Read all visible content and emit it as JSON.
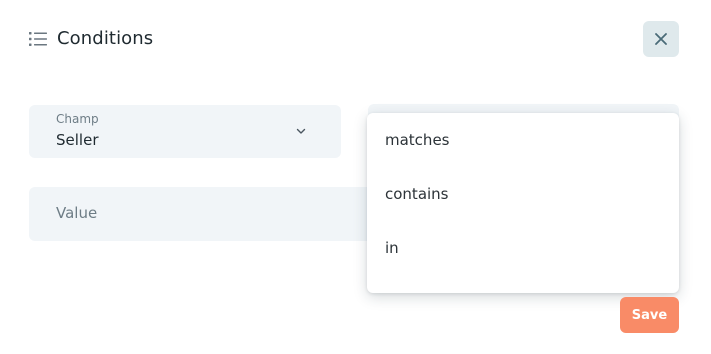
{
  "header": {
    "title": "Conditions",
    "icon": "list-icon"
  },
  "close_button": {
    "icon": "close-icon",
    "color": "#4a6b78"
  },
  "champ_field": {
    "label": "Champ",
    "value": "Seller",
    "icon": "chevron-down-icon"
  },
  "value_field": {
    "placeholder": "Value"
  },
  "operator_dropdown": {
    "options": [
      "matches",
      "contains",
      "in"
    ]
  },
  "save_button": {
    "label": "Save",
    "color": "#f98b67"
  },
  "colors": {
    "field_background": "#f1f5f8",
    "close_background": "#dfe9ec"
  }
}
